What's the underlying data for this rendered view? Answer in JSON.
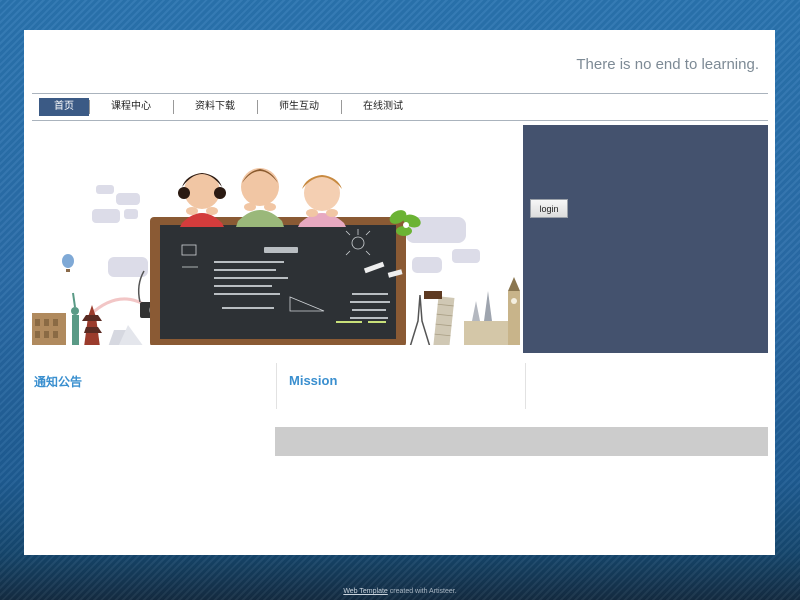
{
  "header": {
    "tagline": "There is no end to learning."
  },
  "menu": {
    "items": [
      {
        "label": "首页",
        "active": true
      },
      {
        "label": "课程中心",
        "active": false
      },
      {
        "label": "资料下载",
        "active": false
      },
      {
        "label": "师生互动",
        "active": false
      },
      {
        "label": "在线测试",
        "active": false
      }
    ]
  },
  "login": {
    "button_label": "login"
  },
  "sections": {
    "notice_title": "通知公告",
    "mission_title": "Mission"
  },
  "footer": {
    "link_text": "Web Template",
    "suffix_text": " created with Artisteer."
  },
  "colors": {
    "accent": "#3a8fcf",
    "menu_active": "#3b5a85",
    "login_panel": "#44526e",
    "gray_bar": "#cccccc"
  }
}
